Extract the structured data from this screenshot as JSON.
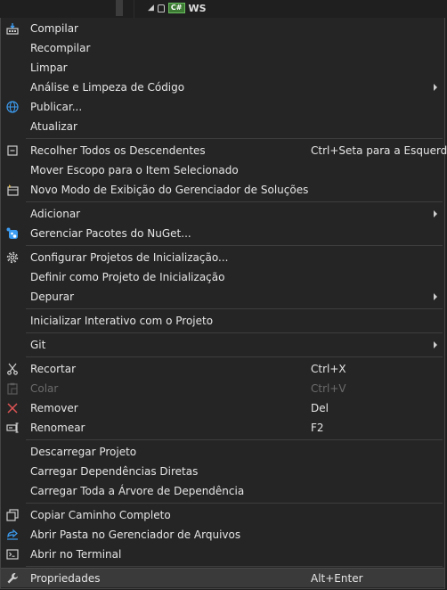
{
  "background": {
    "project_name": "WS",
    "project_badge": "C#"
  },
  "menu": {
    "items": [
      {
        "label": "Compilar"
      },
      {
        "label": "Recompilar"
      },
      {
        "label": "Limpar"
      },
      {
        "label": "Análise e Limpeza de Código"
      },
      {
        "label": "Publicar..."
      },
      {
        "label": "Atualizar"
      },
      {
        "label": "Recolher Todos os Descendentes",
        "shortcut": "Ctrl+Seta para a Esquerda"
      },
      {
        "label": "Mover Escopo para o Item Selecionado"
      },
      {
        "label": "Novo Modo de Exibição do Gerenciador de Soluções"
      },
      {
        "label": "Adicionar"
      },
      {
        "label": "Gerenciar Pacotes do NuGet..."
      },
      {
        "label": "Configurar Projetos de Inicialização..."
      },
      {
        "label": "Definir como Projeto de Inicialização"
      },
      {
        "label": "Depurar"
      },
      {
        "label": "Inicializar Interativo com o Projeto"
      },
      {
        "label": "Git"
      },
      {
        "label": "Recortar",
        "shortcut": "Ctrl+X"
      },
      {
        "label": "Colar",
        "shortcut": "Ctrl+V",
        "disabled": true
      },
      {
        "label": "Remover",
        "shortcut": "Del"
      },
      {
        "label": "Renomear",
        "shortcut": "F2"
      },
      {
        "label": "Descarregar Projeto"
      },
      {
        "label": "Carregar Dependências Diretas"
      },
      {
        "label": "Carregar Toda a Árvore de Dependência"
      },
      {
        "label": "Copiar Caminho Completo"
      },
      {
        "label": "Abrir Pasta no Gerenciador de Arquivos"
      },
      {
        "label": "Abrir no Terminal"
      },
      {
        "label": "Propriedades",
        "shortcut": "Alt+Enter"
      }
    ]
  },
  "colors": {
    "menu_bg": "#252526",
    "text": "#e6e6e6",
    "disabled_text": "#6b6b6b",
    "separator": "#3e3e3e",
    "highlight": "#3a3a3a",
    "remove_icon": "#e05555",
    "accent_blue": "#3c9cf0"
  }
}
